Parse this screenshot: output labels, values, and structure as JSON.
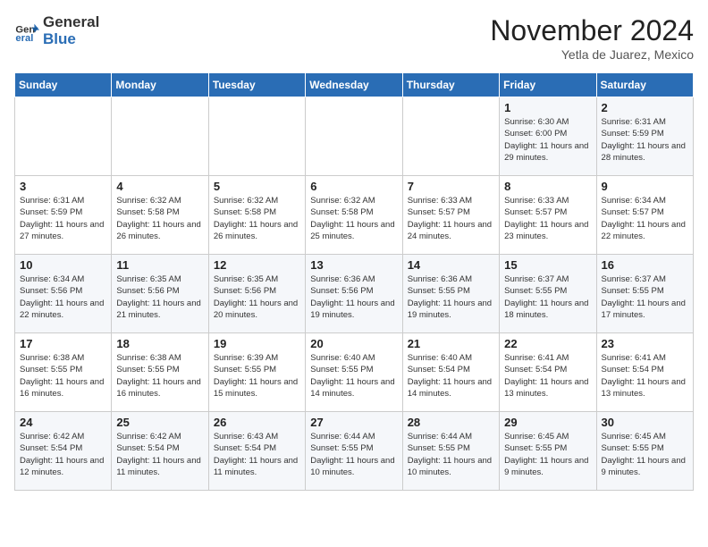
{
  "logo": {
    "line1": "General",
    "line2": "Blue"
  },
  "title": "November 2024",
  "location": "Yetla de Juarez, Mexico",
  "days_of_week": [
    "Sunday",
    "Monday",
    "Tuesday",
    "Wednesday",
    "Thursday",
    "Friday",
    "Saturday"
  ],
  "weeks": [
    [
      {
        "day": "",
        "info": ""
      },
      {
        "day": "",
        "info": ""
      },
      {
        "day": "",
        "info": ""
      },
      {
        "day": "",
        "info": ""
      },
      {
        "day": "",
        "info": ""
      },
      {
        "day": "1",
        "info": "Sunrise: 6:30 AM\nSunset: 6:00 PM\nDaylight: 11 hours and 29 minutes."
      },
      {
        "day": "2",
        "info": "Sunrise: 6:31 AM\nSunset: 5:59 PM\nDaylight: 11 hours and 28 minutes."
      }
    ],
    [
      {
        "day": "3",
        "info": "Sunrise: 6:31 AM\nSunset: 5:59 PM\nDaylight: 11 hours and 27 minutes."
      },
      {
        "day": "4",
        "info": "Sunrise: 6:32 AM\nSunset: 5:58 PM\nDaylight: 11 hours and 26 minutes."
      },
      {
        "day": "5",
        "info": "Sunrise: 6:32 AM\nSunset: 5:58 PM\nDaylight: 11 hours and 26 minutes."
      },
      {
        "day": "6",
        "info": "Sunrise: 6:32 AM\nSunset: 5:58 PM\nDaylight: 11 hours and 25 minutes."
      },
      {
        "day": "7",
        "info": "Sunrise: 6:33 AM\nSunset: 5:57 PM\nDaylight: 11 hours and 24 minutes."
      },
      {
        "day": "8",
        "info": "Sunrise: 6:33 AM\nSunset: 5:57 PM\nDaylight: 11 hours and 23 minutes."
      },
      {
        "day": "9",
        "info": "Sunrise: 6:34 AM\nSunset: 5:57 PM\nDaylight: 11 hours and 22 minutes."
      }
    ],
    [
      {
        "day": "10",
        "info": "Sunrise: 6:34 AM\nSunset: 5:56 PM\nDaylight: 11 hours and 22 minutes."
      },
      {
        "day": "11",
        "info": "Sunrise: 6:35 AM\nSunset: 5:56 PM\nDaylight: 11 hours and 21 minutes."
      },
      {
        "day": "12",
        "info": "Sunrise: 6:35 AM\nSunset: 5:56 PM\nDaylight: 11 hours and 20 minutes."
      },
      {
        "day": "13",
        "info": "Sunrise: 6:36 AM\nSunset: 5:56 PM\nDaylight: 11 hours and 19 minutes."
      },
      {
        "day": "14",
        "info": "Sunrise: 6:36 AM\nSunset: 5:55 PM\nDaylight: 11 hours and 19 minutes."
      },
      {
        "day": "15",
        "info": "Sunrise: 6:37 AM\nSunset: 5:55 PM\nDaylight: 11 hours and 18 minutes."
      },
      {
        "day": "16",
        "info": "Sunrise: 6:37 AM\nSunset: 5:55 PM\nDaylight: 11 hours and 17 minutes."
      }
    ],
    [
      {
        "day": "17",
        "info": "Sunrise: 6:38 AM\nSunset: 5:55 PM\nDaylight: 11 hours and 16 minutes."
      },
      {
        "day": "18",
        "info": "Sunrise: 6:38 AM\nSunset: 5:55 PM\nDaylight: 11 hours and 16 minutes."
      },
      {
        "day": "19",
        "info": "Sunrise: 6:39 AM\nSunset: 5:55 PM\nDaylight: 11 hours and 15 minutes."
      },
      {
        "day": "20",
        "info": "Sunrise: 6:40 AM\nSunset: 5:55 PM\nDaylight: 11 hours and 14 minutes."
      },
      {
        "day": "21",
        "info": "Sunrise: 6:40 AM\nSunset: 5:54 PM\nDaylight: 11 hours and 14 minutes."
      },
      {
        "day": "22",
        "info": "Sunrise: 6:41 AM\nSunset: 5:54 PM\nDaylight: 11 hours and 13 minutes."
      },
      {
        "day": "23",
        "info": "Sunrise: 6:41 AM\nSunset: 5:54 PM\nDaylight: 11 hours and 13 minutes."
      }
    ],
    [
      {
        "day": "24",
        "info": "Sunrise: 6:42 AM\nSunset: 5:54 PM\nDaylight: 11 hours and 12 minutes."
      },
      {
        "day": "25",
        "info": "Sunrise: 6:42 AM\nSunset: 5:54 PM\nDaylight: 11 hours and 11 minutes."
      },
      {
        "day": "26",
        "info": "Sunrise: 6:43 AM\nSunset: 5:54 PM\nDaylight: 11 hours and 11 minutes."
      },
      {
        "day": "27",
        "info": "Sunrise: 6:44 AM\nSunset: 5:55 PM\nDaylight: 11 hours and 10 minutes."
      },
      {
        "day": "28",
        "info": "Sunrise: 6:44 AM\nSunset: 5:55 PM\nDaylight: 11 hours and 10 minutes."
      },
      {
        "day": "29",
        "info": "Sunrise: 6:45 AM\nSunset: 5:55 PM\nDaylight: 11 hours and 9 minutes."
      },
      {
        "day": "30",
        "info": "Sunrise: 6:45 AM\nSunset: 5:55 PM\nDaylight: 11 hours and 9 minutes."
      }
    ]
  ]
}
